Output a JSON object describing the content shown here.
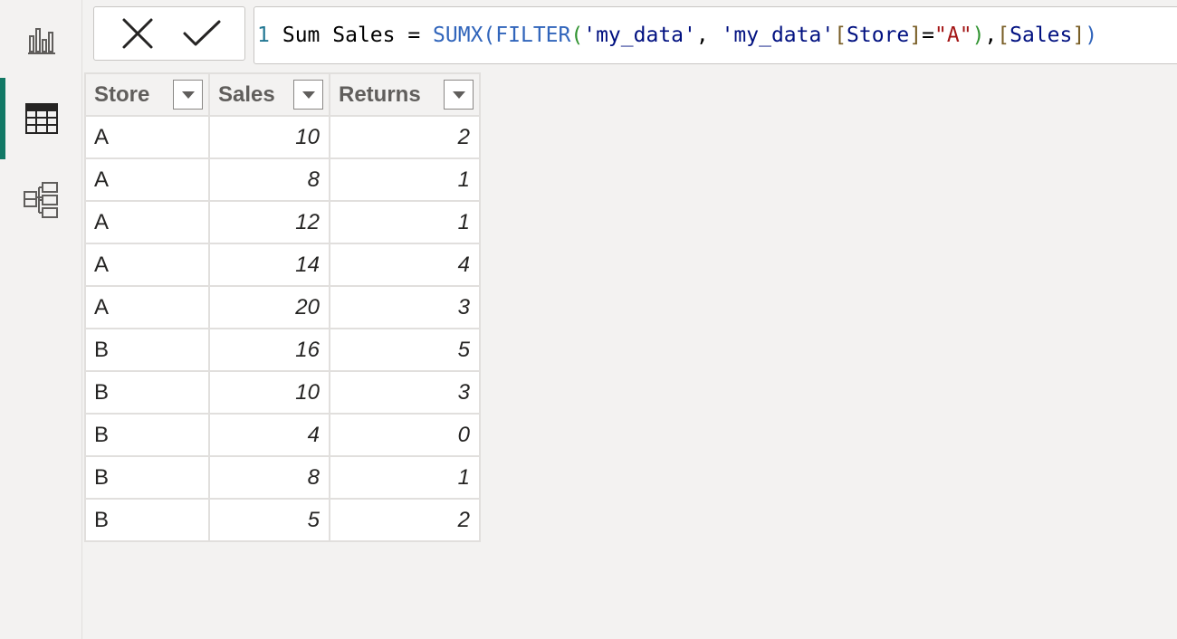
{
  "rail": {
    "items": [
      {
        "name": "report-view",
        "icon": "bar-chart-icon",
        "active": false
      },
      {
        "name": "table-view",
        "icon": "table-grid-icon",
        "active": true
      },
      {
        "name": "model-view",
        "icon": "model-diagram-icon",
        "active": false
      }
    ],
    "accent": "#117865"
  },
  "formula_bar": {
    "line_number": "1",
    "tokens": [
      {
        "text": "Sum Sales = ",
        "kind": "plain"
      },
      {
        "text": "SUMX",
        "kind": "func"
      },
      {
        "text": "(",
        "kind": "paren2"
      },
      {
        "text": "FILTER",
        "kind": "func"
      },
      {
        "text": "(",
        "kind": "paren1"
      },
      {
        "text": "'my_data'",
        "kind": "table"
      },
      {
        "text": ", ",
        "kind": "plain"
      },
      {
        "text": "'my_data'",
        "kind": "table"
      },
      {
        "text": "[",
        "kind": "bracket"
      },
      {
        "text": "Store",
        "kind": "col"
      },
      {
        "text": "]",
        "kind": "bracket"
      },
      {
        "text": "=",
        "kind": "plain"
      },
      {
        "text": "\"A\"",
        "kind": "str"
      },
      {
        "text": ")",
        "kind": "paren1"
      },
      {
        "text": ",",
        "kind": "plain"
      },
      {
        "text": "[",
        "kind": "bracket"
      },
      {
        "text": "Sales",
        "kind": "col"
      },
      {
        "text": "]",
        "kind": "bracket"
      },
      {
        "text": ")",
        "kind": "paren2"
      }
    ]
  },
  "table": {
    "columns": [
      "Store",
      "Sales",
      "Returns"
    ],
    "rows": [
      [
        "A",
        "10",
        "2"
      ],
      [
        "A",
        "8",
        "1"
      ],
      [
        "A",
        "12",
        "1"
      ],
      [
        "A",
        "14",
        "4"
      ],
      [
        "A",
        "20",
        "3"
      ],
      [
        "B",
        "16",
        "5"
      ],
      [
        "B",
        "10",
        "3"
      ],
      [
        "B",
        "4",
        "0"
      ],
      [
        "B",
        "8",
        "1"
      ],
      [
        "B",
        "5",
        "2"
      ]
    ]
  }
}
